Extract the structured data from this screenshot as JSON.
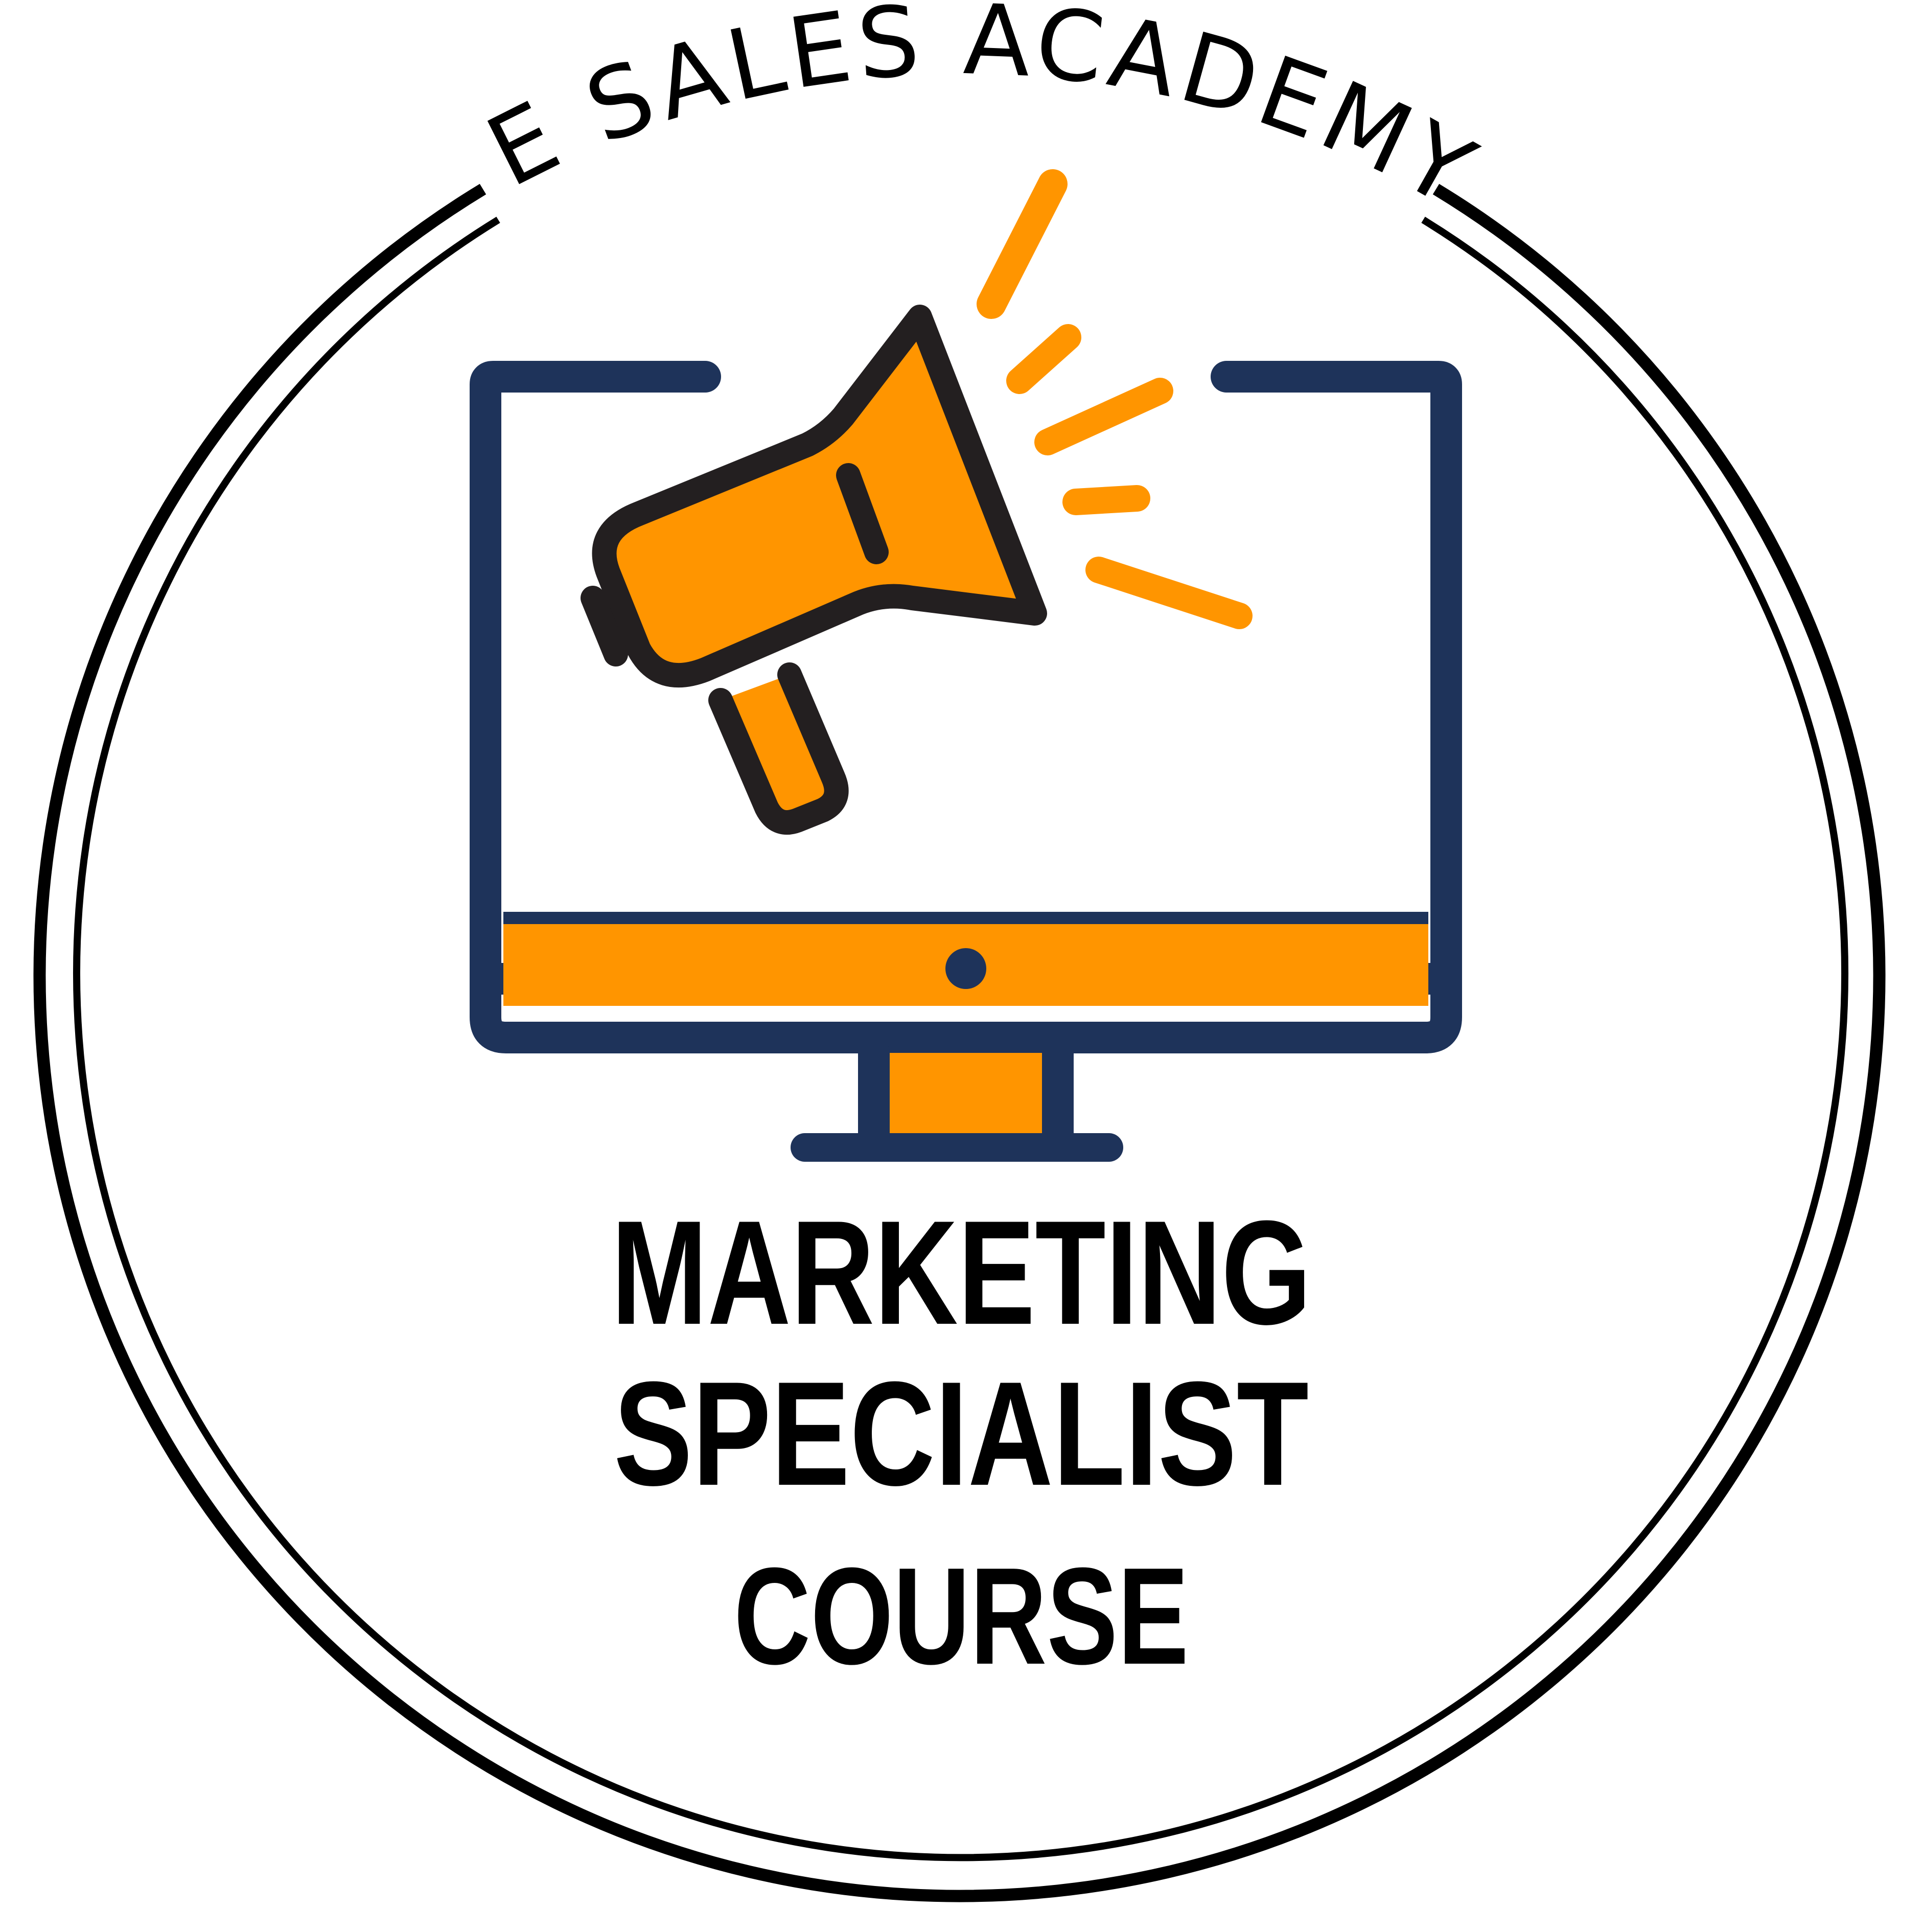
{
  "badge": {
    "arc_text": "THE SALES ACADEMY'S",
    "title_line1": "MARKETING",
    "title_line2": "SPECIALIST",
    "title_line3": "COURSE"
  },
  "icons": {
    "main": "monitor-megaphone-icon"
  },
  "colors": {
    "navy": "#1e335a",
    "orange": "#ff9500",
    "dark": "#231f20",
    "ring": "#000000",
    "background": "#ffffff"
  }
}
